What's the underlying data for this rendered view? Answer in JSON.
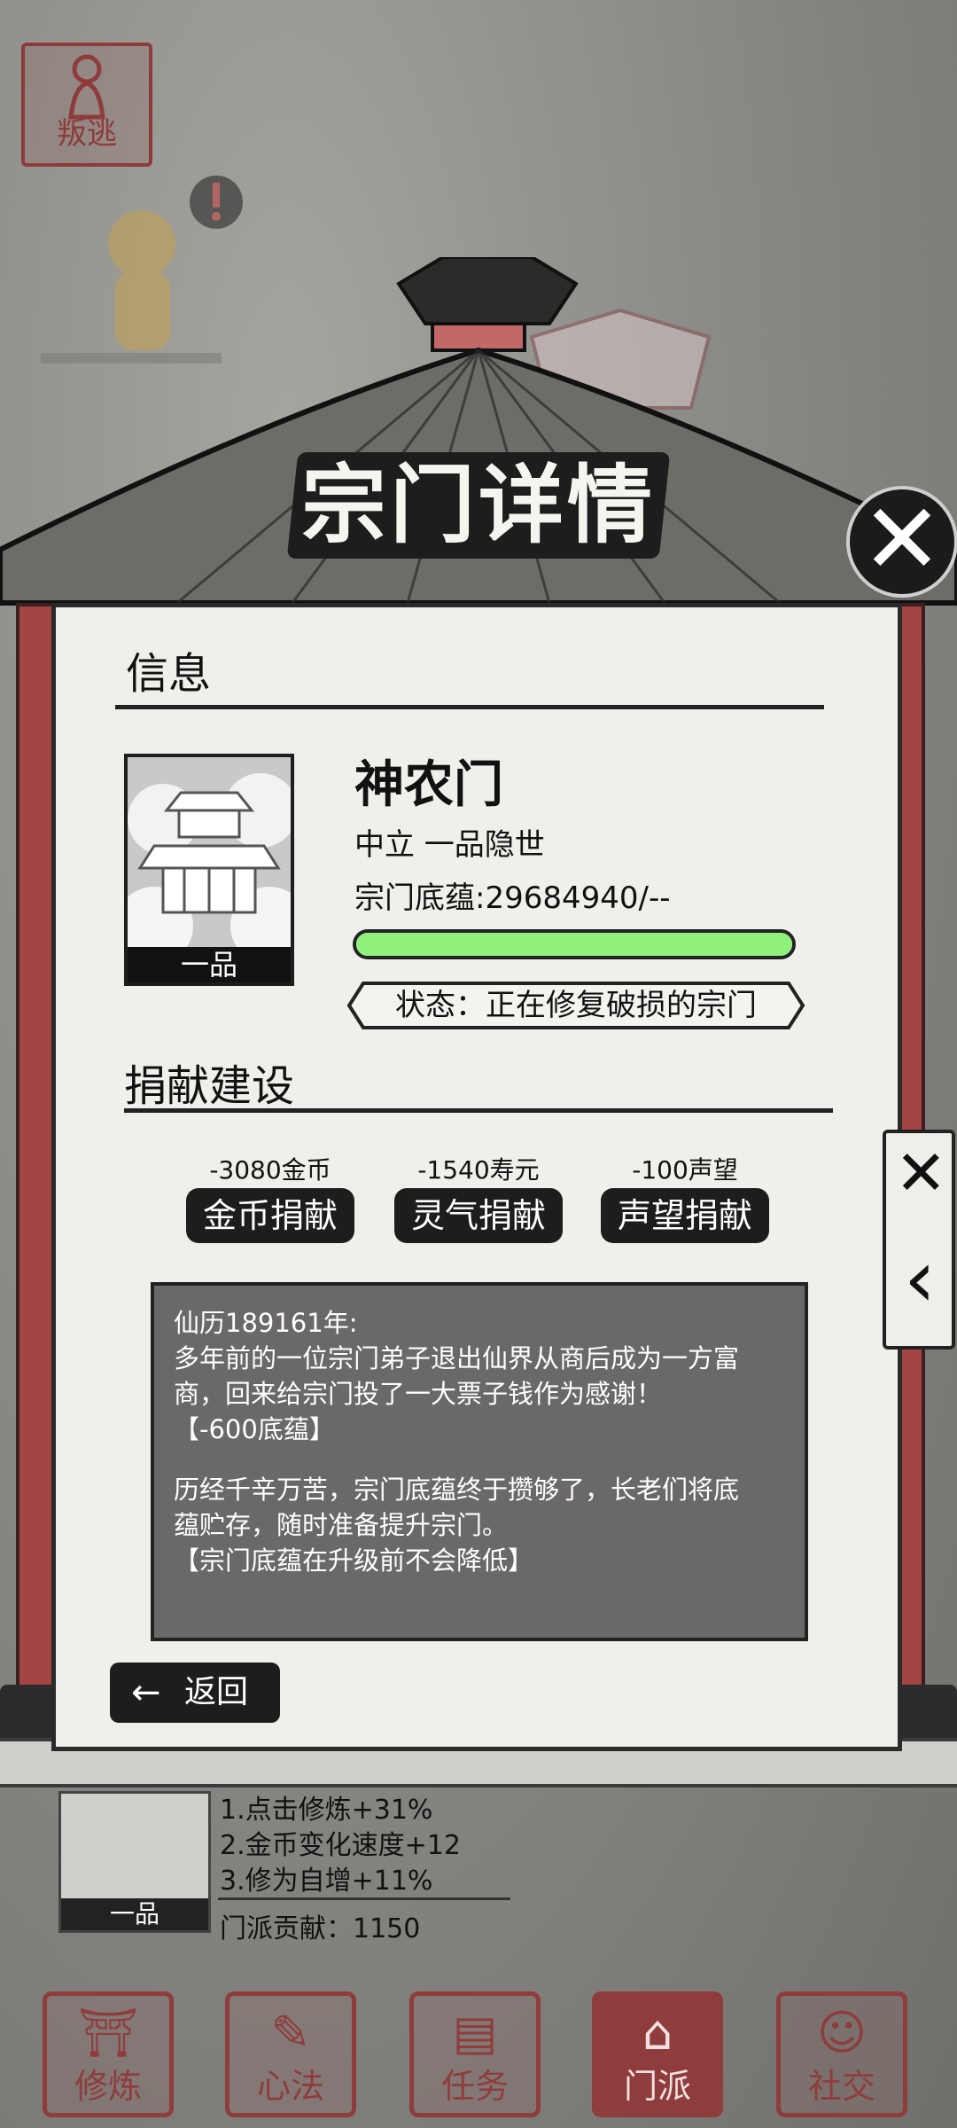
{
  "defect": {
    "label": "叛逃"
  },
  "title": "宗门详情",
  "info_section": {
    "heading": "信息"
  },
  "sect": {
    "name": "神农门",
    "subtitle": "中立 一品隐世",
    "foundation": "宗门底蕴:29684940/--",
    "rank_badge": "一品",
    "progress": 1.0,
    "status": "状态：正在修复破损的宗门"
  },
  "donation_section": {
    "heading": "捐献建设",
    "items": [
      {
        "cost": "-3080金币",
        "label": "金币捐献"
      },
      {
        "cost": "-1540寿元",
        "label": "灵气捐献"
      },
      {
        "cost": "-100声望",
        "label": "声望捐献"
      }
    ]
  },
  "log": {
    "lines1": [
      "仙历189161年:",
      "多年前的一位宗门弟子退出仙界从商后成为一方富",
      "商，回来给宗门投了一大票子钱作为感谢！",
      "【-600底蕴】"
    ],
    "lines2": [
      "历经千辛万苦，宗门底蕴终于攒够了，长老们将底",
      "蕴贮存，随时准备提升宗门。",
      "【宗门底蕴在升级前不会降低】"
    ]
  },
  "back": {
    "label": "返回"
  },
  "behind": {
    "rank_badge": "一品",
    "bonuses": [
      "1.点击修炼+31%",
      "2.金币变化速度+12",
      "3.修为自增+11%"
    ],
    "contribution": "门派贡献：1150"
  },
  "nav": [
    {
      "label": "修炼",
      "icon": "meditate-icon"
    },
    {
      "label": "心法",
      "icon": "scroll-icon"
    },
    {
      "label": "任务",
      "icon": "task-scroll-icon"
    },
    {
      "label": "门派",
      "icon": "sect-gate-icon"
    },
    {
      "label": "社交",
      "icon": "people-icon"
    }
  ],
  "colors": {
    "accent": "#8f3c3c",
    "progress": "#8ff07c",
    "panel": "#efefeb"
  }
}
